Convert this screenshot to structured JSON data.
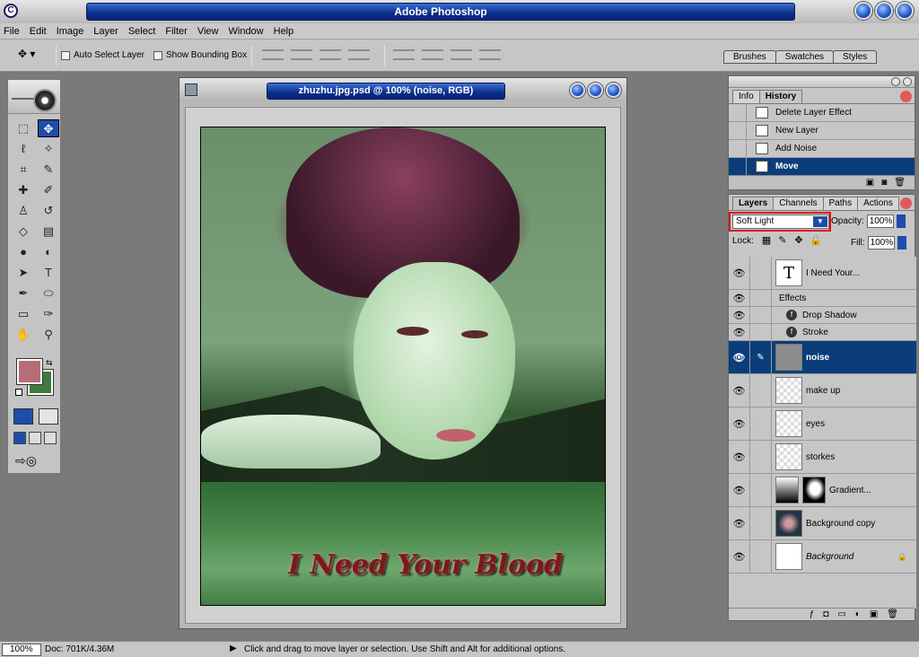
{
  "app": {
    "title": "Adobe Photoshop"
  },
  "menu": [
    "File",
    "Edit",
    "Image",
    "Layer",
    "Select",
    "Filter",
    "View",
    "Window",
    "Help"
  ],
  "options": {
    "auto_select": "Auto Select Layer",
    "show_bbox": "Show Bounding Box",
    "dock_tabs": [
      "Brushes",
      "Swatches",
      "Styles"
    ]
  },
  "colors": {
    "foreground": "#b56d77",
    "background": "#3f7a3f",
    "accent": "#0a3d7a"
  },
  "document": {
    "title": "zhuzhu.jpg.psd @ 100% (noise, RGB)",
    "caption": "I Need Your Blood"
  },
  "history": {
    "tabs": [
      "Info",
      "History"
    ],
    "items": [
      {
        "label": "Delete Layer Effect"
      },
      {
        "label": "New Layer"
      },
      {
        "label": "Add Noise"
      },
      {
        "label": "Move"
      }
    ]
  },
  "layers": {
    "tabs": [
      "Layers",
      "Channels",
      "Paths",
      "Actions"
    ],
    "blend_mode": "Soft Light",
    "opacity_label": "Opacity:",
    "opacity": "100%",
    "lock_label": "Lock:",
    "fill_label": "Fill:",
    "fill": "100%",
    "items": [
      {
        "name": "I Need Your..."
      },
      {
        "name": "Effects"
      },
      {
        "name": "Drop Shadow"
      },
      {
        "name": "Stroke"
      },
      {
        "name": "noise"
      },
      {
        "name": "make up"
      },
      {
        "name": "eyes"
      },
      {
        "name": "storkes"
      },
      {
        "name": "Gradient..."
      },
      {
        "name": "Background copy"
      },
      {
        "name": "Background"
      }
    ]
  },
  "status": {
    "zoom": "100%",
    "doc": "Doc: 701K/4.36M",
    "message": "Click and drag to move layer or selection.  Use Shift and Alt for additional options."
  }
}
